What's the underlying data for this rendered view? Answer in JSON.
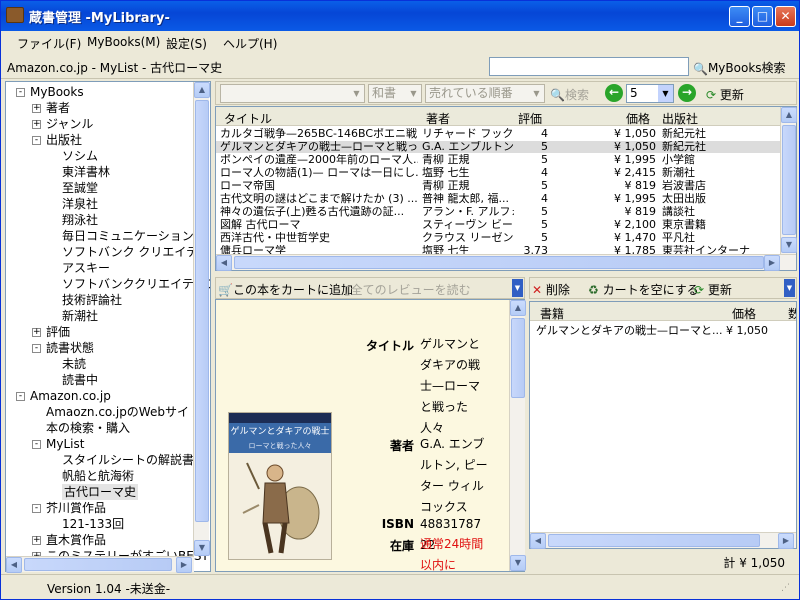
{
  "window": {
    "title": "蔵書管理 -MyLibrary-"
  },
  "menu": [
    "ファイル(F)",
    "MyBooks(M)",
    "設定(S)",
    "ヘルプ(H)"
  ],
  "address": {
    "path": "Amazon.co.jp - MyList - 古代ローマ史",
    "search_button": "MyBooks検索",
    "search_value": ""
  },
  "tree": [
    {
      "label": "MyBooks",
      "level": 0,
      "expander": "-"
    },
    {
      "label": "著者",
      "level": 1,
      "expander": "+"
    },
    {
      "label": "ジャンル",
      "level": 1,
      "expander": "+"
    },
    {
      "label": "出版社",
      "level": 1,
      "expander": "-"
    },
    {
      "label": "ソシム",
      "level": 2,
      "expander": ""
    },
    {
      "label": "東洋書林",
      "level": 2,
      "expander": ""
    },
    {
      "label": "至誠堂",
      "level": 2,
      "expander": ""
    },
    {
      "label": "洋泉社",
      "level": 2,
      "expander": ""
    },
    {
      "label": "翔泳社",
      "level": 2,
      "expander": ""
    },
    {
      "label": "毎日コミュニケーションズ",
      "level": 2,
      "expander": ""
    },
    {
      "label": "ソフトバンク クリエイティブ",
      "level": 2,
      "expander": ""
    },
    {
      "label": "アスキー",
      "level": 2,
      "expander": ""
    },
    {
      "label": "ソフトバンククリエイティブ",
      "level": 2,
      "expander": ""
    },
    {
      "label": "技術評論社",
      "level": 2,
      "expander": ""
    },
    {
      "label": "新潮社",
      "level": 2,
      "expander": ""
    },
    {
      "label": "評価",
      "level": 1,
      "expander": "+"
    },
    {
      "label": "読書状態",
      "level": 1,
      "expander": "-"
    },
    {
      "label": "未読",
      "level": 2,
      "expander": ""
    },
    {
      "label": "読書中",
      "level": 2,
      "expander": ""
    },
    {
      "label": "Amazon.co.jp",
      "level": 0,
      "expander": "-"
    },
    {
      "label": "Amaozn.co.jpのWebサイト",
      "level": 1,
      "expander": ""
    },
    {
      "label": "本の検索・購入",
      "level": 1,
      "expander": ""
    },
    {
      "label": "MyList",
      "level": 1,
      "expander": "-"
    },
    {
      "label": "スタイルシートの解説書",
      "level": 2,
      "expander": ""
    },
    {
      "label": "帆船と航海術",
      "level": 2,
      "expander": ""
    },
    {
      "label": "古代ローマ史",
      "level": 2,
      "expander": "",
      "selected": true
    },
    {
      "label": "芥川賞作品",
      "level": 1,
      "expander": "-"
    },
    {
      "label": "121-133回",
      "level": 2,
      "expander": ""
    },
    {
      "label": "直木賞作品",
      "level": 1,
      "expander": "+"
    },
    {
      "label": "このミステリーがすごいBEST",
      "level": 1,
      "expander": "+"
    }
  ],
  "toolbar": {
    "combo1": "",
    "combo2": "和書",
    "combo3": "売れている順番",
    "search": "検索",
    "page": "5",
    "refresh": "更新"
  },
  "list": {
    "headers": [
      "タイトル",
      "著者",
      "評価",
      "価格",
      "出版社"
    ],
    "rows": [
      [
        "カルタゴ戦争—265BC-146BCポエニ戦...",
        "リチャード フック, ...",
        "4",
        "¥ 1,050",
        "新紀元社"
      ],
      [
        "ゲルマンとダキアの戦士—ローマと戦った...",
        "G.A. エンブルトン,...",
        "5",
        "¥ 1,050",
        "新紀元社"
      ],
      [
        "ポンペイの遺産—2000年前のローマ人...",
        "青柳 正規",
        "5",
        "¥ 1,995",
        "小学館"
      ],
      [
        "ローマ人の物語(1)— ローマは一日にし...",
        "塩野 七生",
        "4",
        "¥ 2,415",
        "新潮社"
      ],
      [
        "ローマ帝国",
        "青柳 正規",
        "5",
        "¥ 819",
        "岩波書店"
      ],
      [
        "古代文明の謎はどこまで解けたか (3) ...",
        "普神 龍太郎, 福...",
        "4",
        "¥ 1,995",
        "太田出版"
      ],
      [
        "神々の遺伝子(上)甦る古代遺跡の証...",
        "アラン・F. アルフォ...",
        "5",
        "¥ 819",
        "講談社"
      ],
      [
        "図解 古代ローマ",
        "スティーヴン ビー...",
        "5",
        "¥ 2,100",
        "東京書籍"
      ],
      [
        "西洋古代・中世哲学史",
        "クラウス リーゼンフ...",
        "5",
        "¥ 1,470",
        "平凡社"
      ],
      [
        "傭兵ローマ学",
        "塩野 七生",
        "3.73",
        "¥ 1,785",
        "東芸社インターナ"
      ]
    ],
    "selected_index": 1
  },
  "detail": {
    "add_to_cart": "この本をカートに追加",
    "read_reviews": "全てのレビューを読む",
    "fields": [
      {
        "label": "タイトル",
        "value": "ゲルマンとダキアの戦士—ローマと戦った人々"
      },
      {
        "label": "著者",
        "value": "G.A. エンブルトン, ピーター ウィルコックス"
      },
      {
        "label": "ISBN",
        "value": "4883178722"
      },
      {
        "label": "在庫",
        "value": "通常24時間以内に"
      }
    ],
    "cover": {
      "title": "ゲルマンとダキアの戦士",
      "subtitle": "ローマと戦った人々"
    }
  },
  "cart": {
    "delete": "削除",
    "empty": "カートを空にする",
    "refresh": "更新",
    "headers": [
      "書籍",
      "価格",
      "数"
    ],
    "rows": [
      [
        "ゲルマンとダキアの戦士—ローマと...",
        "¥ 1,050"
      ]
    ],
    "total": "計 ¥ 1,050"
  },
  "status": "Version 1.04 -未送金-",
  "colors": {
    "titlebar": "#0646d6",
    "stock_red": "#e01010",
    "panel": "#ECE9D8",
    "detail_bg": "#fcf8e0"
  }
}
